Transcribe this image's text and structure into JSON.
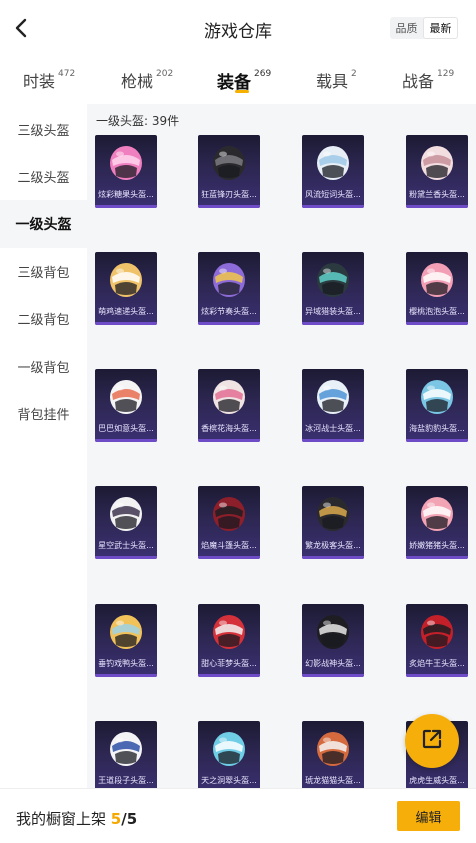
{
  "header": {
    "title": "游戏仓库",
    "sort_options": [
      "品质",
      "最新"
    ],
    "sort_selected": "最新"
  },
  "tabs": [
    {
      "label": "时装",
      "count": "472",
      "active": false
    },
    {
      "label": "枪械",
      "count": "202",
      "active": false
    },
    {
      "label": "装备",
      "count": "269",
      "active": true
    },
    {
      "label": "载具",
      "count": "2",
      "active": false
    },
    {
      "label": "战备",
      "count": "129",
      "active": false
    }
  ],
  "sidebar": {
    "items": [
      {
        "label": "三级头盔",
        "active": false
      },
      {
        "label": "二级头盔",
        "active": false
      },
      {
        "label": "一级头盔",
        "active": true
      },
      {
        "label": "三级背包",
        "active": false
      },
      {
        "label": "二级背包",
        "active": false
      },
      {
        "label": "一级背包",
        "active": false
      },
      {
        "label": "背包挂件",
        "active": false
      }
    ]
  },
  "content": {
    "section_title": "一级头盔: 39件",
    "items": [
      {
        "name": "炫彩糖果头盔...",
        "colors": [
          "#f07fc0",
          "#ffd3ec"
        ]
      },
      {
        "name": "狂蓝锋刃头盔...",
        "colors": [
          "#2a2a2e",
          "#7a7a80"
        ]
      },
      {
        "name": "风流短词头盔...",
        "colors": [
          "#e7eef5",
          "#9cc8e6"
        ]
      },
      {
        "name": "粉黛兰香头盔...",
        "colors": [
          "#f2dde0",
          "#c58f98"
        ]
      },
      {
        "name": "萌鸡速递头盔...",
        "colors": [
          "#f0c36a",
          "#ffffff"
        ]
      },
      {
        "name": "炫彩节奏头盔...",
        "colors": [
          "#8d6bd8",
          "#f2c74b"
        ]
      },
      {
        "name": "异域猎装头盔...",
        "colors": [
          "#2b3a3f",
          "#5fd0c8"
        ]
      },
      {
        "name": "樱桃泡泡头盔...",
        "colors": [
          "#f29fb6",
          "#ffffff"
        ]
      },
      {
        "name": "巴巴如意头盔...",
        "colors": [
          "#f4f4f4",
          "#e66d4f"
        ]
      },
      {
        "name": "香槟花海头盔...",
        "colors": [
          "#f0e3e3",
          "#e36f94"
        ]
      },
      {
        "name": "冰河战士头盔...",
        "colors": [
          "#e8f0f8",
          "#4e93d6"
        ]
      },
      {
        "name": "海盐豹豹头盔...",
        "colors": [
          "#7ac6e4",
          "#ffffff"
        ]
      },
      {
        "name": "星空武士头盔...",
        "colors": [
          "#f2f2f2",
          "#3d3550"
        ]
      },
      {
        "name": "焰魔斗篷头盔...",
        "colors": [
          "#8d1f2b",
          "#1d1d22"
        ]
      },
      {
        "name": "繁龙极客头盔...",
        "colors": [
          "#2a2a2e",
          "#d9a84b"
        ]
      },
      {
        "name": "娇嫩猪猪头盔...",
        "colors": [
          "#f2a3b4",
          "#ffffff"
        ]
      },
      {
        "name": "垂钓戏鸭头盔...",
        "colors": [
          "#f2c25a",
          "#9fd2e8"
        ]
      },
      {
        "name": "甜心菲梦头盔...",
        "colors": [
          "#d4313a",
          "#f2f2f2"
        ]
      },
      {
        "name": "幻影战神头盔...",
        "colors": [
          "#1d1d22",
          "#e8e8e8"
        ]
      },
      {
        "name": "炙焰牛王头盔...",
        "colors": [
          "#c4202a",
          "#1d1d22"
        ]
      },
      {
        "name": "王道段子头盔...",
        "colors": [
          "#f4f4f6",
          "#2d4fa6"
        ]
      },
      {
        "name": "天之洞翠头盔...",
        "colors": [
          "#6fcde6",
          "#ffffff"
        ]
      },
      {
        "name": "琥龙猫猫头盔...",
        "colors": [
          "#d56a3f",
          "#f4f4f4"
        ]
      },
      {
        "name": "虎虎生威头盔...",
        "colors": [
          "#f2a23a",
          "#ffffff"
        ]
      }
    ]
  },
  "bottom_bar": {
    "shelf_label": "我的橱窗上架",
    "shelf_current": "5",
    "shelf_separator": "/",
    "shelf_total": "5",
    "edit_label": "编辑"
  },
  "icons": {
    "back": "back-arrow-icon",
    "fab": "share-icon"
  },
  "colors": {
    "accent": "#f6ae0a",
    "card_bg": "#2d2752",
    "card_stripe": "#6f4cc7"
  }
}
